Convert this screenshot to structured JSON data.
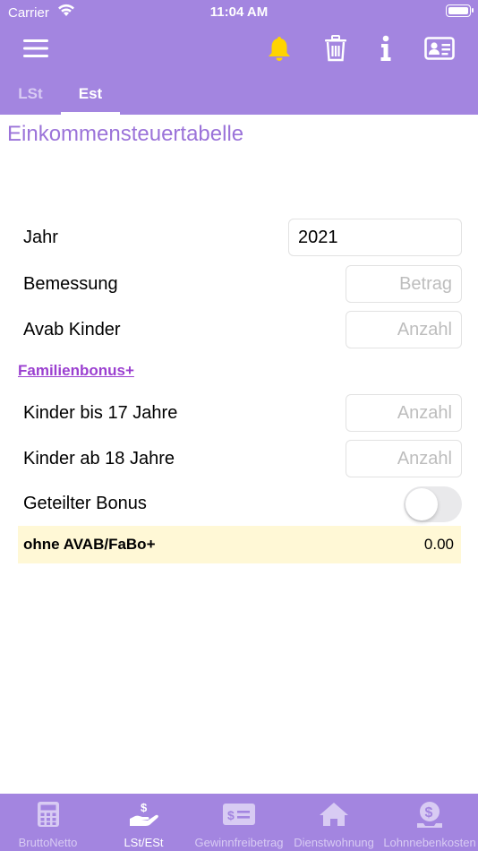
{
  "status_bar": {
    "carrier": "Carrier",
    "time": "11:04 AM"
  },
  "toolbar": {
    "icons": [
      "menu-icon",
      "bell-icon",
      "trash-icon",
      "info-icon",
      "contact-card-icon"
    ],
    "bell_color": "#FFD400"
  },
  "tabs": [
    {
      "label": "LSt",
      "active": false
    },
    {
      "label": "Est",
      "active": true
    }
  ],
  "page_title": "Einkommensteuertabelle",
  "form": {
    "jahr": {
      "label": "Jahr",
      "value": "2021"
    },
    "bemessung": {
      "label": "Bemessung",
      "placeholder": "Betrag"
    },
    "avab_kinder": {
      "label": "Avab Kinder",
      "placeholder": "Anzahl"
    },
    "familienbonus_link": "Familienbonus+",
    "kinder_bis_17": {
      "label": "Kinder bis 17 Jahre",
      "placeholder": "Anzahl"
    },
    "kinder_ab_18": {
      "label": "Kinder ab 18 Jahre",
      "placeholder": "Anzahl"
    },
    "geteilter_bonus": {
      "label": "Geteilter Bonus",
      "on": false
    }
  },
  "result": {
    "label": "ohne AVAB/FaBo+",
    "value": "0.00"
  },
  "tabbar": [
    {
      "label": "BruttoNetto",
      "icon": "calculator-icon",
      "active": false
    },
    {
      "label": "LSt/ESt",
      "icon": "hand-dollar-icon",
      "active": true
    },
    {
      "label": "Gewinnfreibetrag",
      "icon": "check-money-icon",
      "active": false
    },
    {
      "label": "Dienstwohnung",
      "icon": "house-icon",
      "active": false
    },
    {
      "label": "Lohnnebenkosten",
      "icon": "dollar-coin-hand-icon",
      "active": false
    }
  ],
  "colors": {
    "accent": "#A385E0",
    "title": "#9B73D9",
    "link": "#9B40D0",
    "result_bg": "#FFF8D6"
  }
}
